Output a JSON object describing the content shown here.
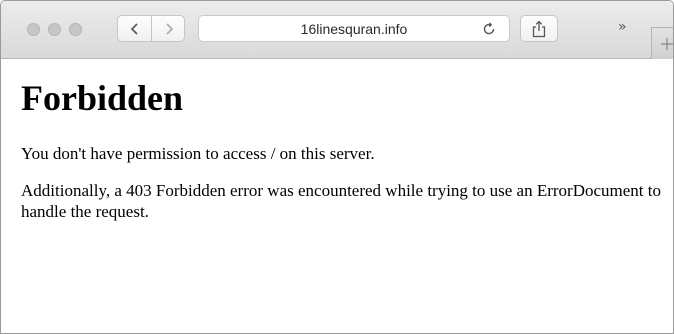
{
  "browser": {
    "url": "16linesquran.info",
    "overflow_label": "»",
    "new_tab_label": "+"
  },
  "page": {
    "heading": "Forbidden",
    "message": "You don't have permission to access / on this server.",
    "additional": "Additionally, a 403 Forbidden error was encountered while trying to use an ErrorDocument to handle the request."
  },
  "colors": {
    "toolbar": "#dedede",
    "traffic_light": "#c6c6c6"
  }
}
